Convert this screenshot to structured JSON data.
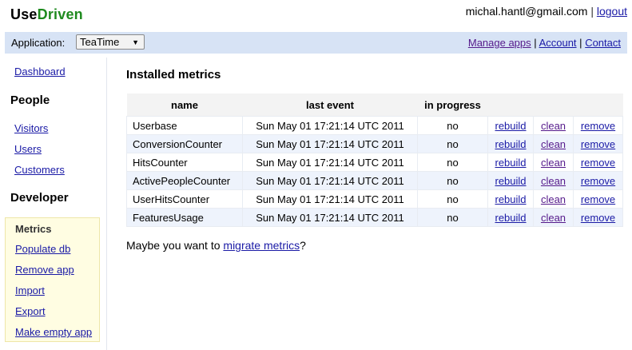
{
  "brand": {
    "part1": "Use",
    "part2": "Driven"
  },
  "user": {
    "email": "michal.hantl@gmail.com",
    "separator": "|",
    "logout_label": "logout"
  },
  "appbar": {
    "label": "Application:",
    "selected_app": "TeaTime",
    "links": [
      {
        "label": "Manage apps"
      },
      {
        "label": "Account"
      },
      {
        "label": "Contact"
      }
    ],
    "separator": "|"
  },
  "sidebar": {
    "dashboard": "Dashboard",
    "people_heading": "People",
    "people_items": [
      "Visitors",
      "Users",
      "Customers"
    ],
    "developer_heading": "Developer",
    "developer_current": "Metrics",
    "developer_items": [
      "Populate db",
      "Remove app",
      "Import",
      "Export",
      "Make empty app"
    ]
  },
  "main": {
    "title": "Installed metrics",
    "columns": [
      "name",
      "last event",
      "in progress"
    ],
    "rows": [
      {
        "name": "Userbase",
        "last_event": "Sun May 01 17:21:14 UTC 2011",
        "in_progress": "no",
        "rebuild": "rebuild",
        "clean": "clean",
        "remove": "remove"
      },
      {
        "name": "ConversionCounter",
        "last_event": "Sun May 01 17:21:14 UTC 2011",
        "in_progress": "no",
        "rebuild": "rebuild",
        "clean": "clean",
        "remove": "remove"
      },
      {
        "name": "HitsCounter",
        "last_event": "Sun May 01 17:21:14 UTC 2011",
        "in_progress": "no",
        "rebuild": "rebuild",
        "clean": "clean",
        "remove": "remove"
      },
      {
        "name": "ActivePeopleCounter",
        "last_event": "Sun May 01 17:21:14 UTC 2011",
        "in_progress": "no",
        "rebuild": "rebuild",
        "clean": "clean",
        "remove": "remove"
      },
      {
        "name": "UserHitsCounter",
        "last_event": "Sun May 01 17:21:14 UTC 2011",
        "in_progress": "no",
        "rebuild": "rebuild",
        "clean": "clean",
        "remove": "remove"
      },
      {
        "name": "FeaturesUsage",
        "last_event": "Sun May 01 17:21:14 UTC 2011",
        "in_progress": "no",
        "rebuild": "rebuild",
        "clean": "clean",
        "remove": "remove"
      }
    ],
    "migrate_prefix": "Maybe you want to ",
    "migrate_link": "migrate metrics",
    "migrate_suffix": "?"
  },
  "colors": {
    "brand_green": "#1e8a1e",
    "link": "#1a1aa6",
    "visited": "#551a8b",
    "appbar_bg": "#d7e3f5",
    "devbox_bg": "#fffde2"
  }
}
